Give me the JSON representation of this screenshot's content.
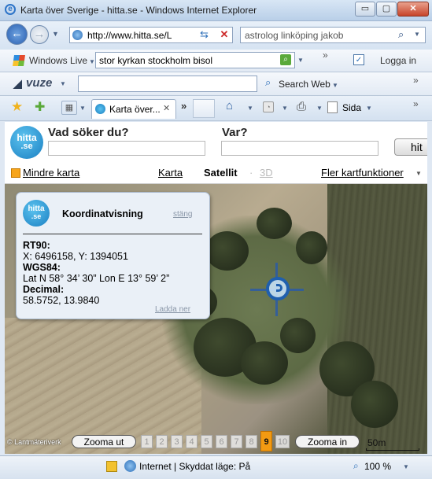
{
  "window": {
    "title": "Karta över Sverige - hitta.se - Windows Internet Explorer",
    "minimize_glyph": "▭",
    "maximize_glyph": "▢",
    "close_glyph": "✕"
  },
  "address_bar": {
    "url": "http://www.hitta.se/L",
    "refresh_glyph": "⇆",
    "stop_glyph": "✕",
    "search_value": "astrolog linköping jakob"
  },
  "windows_live_bar": {
    "label": "Windows Live",
    "search_value": "stor kyrkan stockholm bisol",
    "login_label": "Logga in"
  },
  "vuze_bar": {
    "label": "vuze",
    "search_label": "Search Web"
  },
  "tab_bar": {
    "tab_label": "Karta över...",
    "tab_close": "✕",
    "more_tabs": "»",
    "page_menu": "Sida"
  },
  "hitta_header": {
    "logo_top": "hitta",
    "logo_bottom": ".se",
    "what_label": "Vad söker du?",
    "where_label": "Var?",
    "search_button": "hit"
  },
  "map_nav": {
    "smaller_map": "Mindre karta",
    "tab_map": "Karta",
    "tab_satellite": "Satellit",
    "tab_3d": "3D",
    "more_functions": "Fler kartfunktioner"
  },
  "coord_panel": {
    "logo_top": "hitta",
    "logo_bottom": ".se",
    "title": "Koordinatvisning",
    "close": "stäng",
    "rt90_label": "RT90:",
    "rt90_value": "X: 6496158, Y: 1394051",
    "wgs84_label": "WGS84:",
    "wgs84_value": "Lat N 58° 34’ 30” Lon E 13° 59’ 2”",
    "decimal_label": "Decimal:",
    "decimal_value": "58.5752, 13.9840",
    "download": "Ladda ner"
  },
  "map_controls": {
    "copyright": "© Lantmäteriverk",
    "zoom_out": "Zooma ut",
    "zoom_in": "Zooma in",
    "levels": [
      "1",
      "2",
      "3",
      "4",
      "5",
      "6",
      "7",
      "8",
      "9",
      "10"
    ],
    "active_level": "9",
    "scale": "50m"
  },
  "status_bar": {
    "zone": "Internet | Skyddat läge: På",
    "zoom": "100 %"
  },
  "colors": {
    "hitta_blue": "#1a7fc2",
    "active_zoom": "#f29a12",
    "panel_bg": "#eaf0f7"
  }
}
